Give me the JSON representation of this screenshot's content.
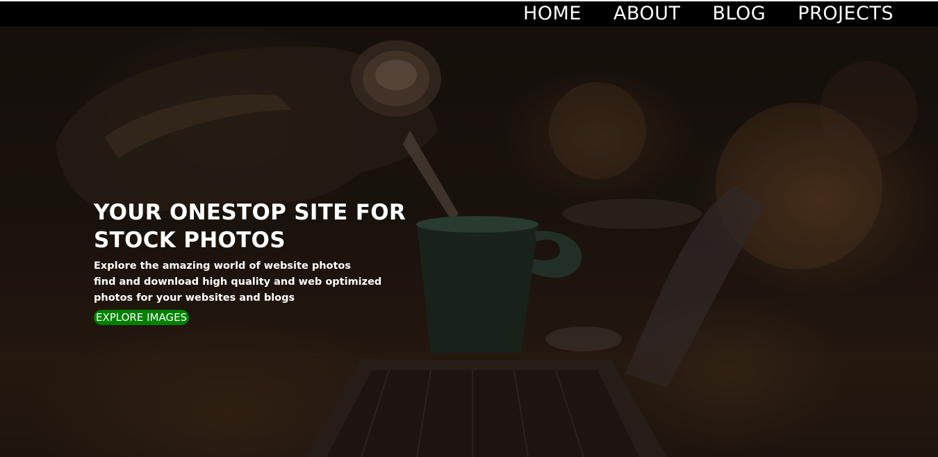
{
  "nav": {
    "items": [
      {
        "label": "HOME"
      },
      {
        "label": "ABOUT"
      },
      {
        "label": "BLOG"
      },
      {
        "label": "PROJECTS"
      }
    ]
  },
  "hero": {
    "title_line1": "YOUR ONESTOP SITE FOR",
    "title_line2": "STOCK PHOTOS",
    "description_lines": [
      "Explore the amazing world of website photos",
      "find and download high quality and web optimized",
      "photos for your websites and blogs"
    ],
    "cta_label": "EXPLORE IMAGES",
    "background_image": "coffee-pour-laptop-photo"
  },
  "colors": {
    "nav_background": "#000000",
    "nav_text": "#ffffff",
    "hero_text": "#ffffff",
    "cta_background": "#008000",
    "cta_text": "#ffffff"
  }
}
